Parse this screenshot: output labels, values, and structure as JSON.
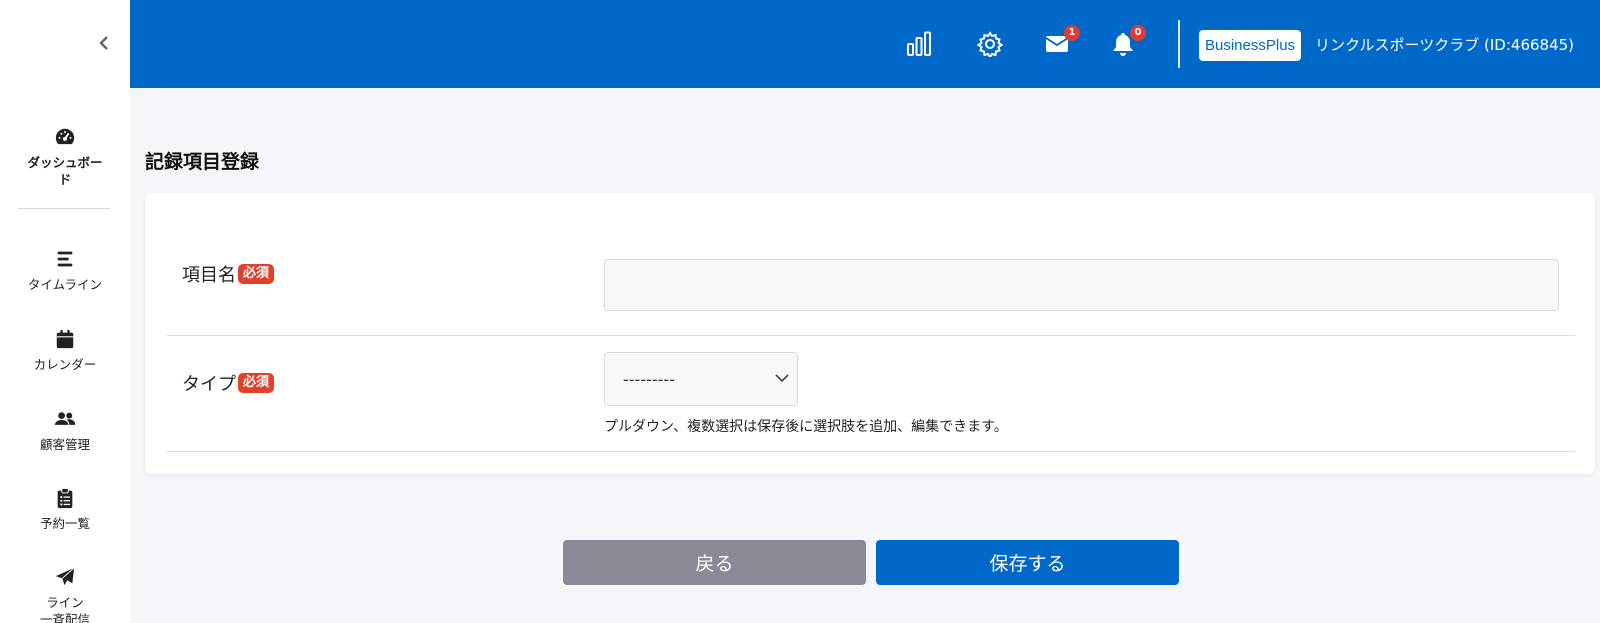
{
  "sidebar": {
    "items": [
      {
        "label": "ダッシュボード",
        "icon": "dashboard-gauge-icon"
      },
      {
        "label": "タイムライン",
        "icon": "timeline-bars-icon"
      },
      {
        "label": "カレンダー",
        "icon": "calendar-icon"
      },
      {
        "label": "顧客管理",
        "icon": "users-icon"
      },
      {
        "label": "予約一覧",
        "icon": "clipboard-list-icon"
      },
      {
        "label": "ライン\n一斉配信",
        "icon": "paper-plane-icon"
      }
    ]
  },
  "header": {
    "mail_count": "1",
    "notification_count": "0",
    "plan": "BusinessPlus",
    "account": "リンクルスポーツクラブ (ID:466845)"
  },
  "page": {
    "title": "記録項目登録"
  },
  "form": {
    "item_name_label": "項目名",
    "type_label": "タイプ",
    "required_badge": "必須",
    "item_name_value": "",
    "type_selected": "---------",
    "type_help": "プルダウン、複数選択は保存後に選択肢を追加、編集できます。"
  },
  "actions": {
    "back": "戻る",
    "save": "保存する"
  },
  "colors": {
    "primary": "#0068c9",
    "required": "#e0412b",
    "back_button": "#8a8a96",
    "badge": "#e53935"
  }
}
